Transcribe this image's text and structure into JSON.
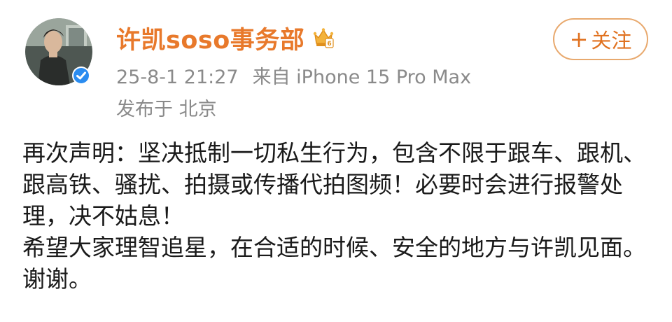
{
  "post": {
    "author": {
      "name": "许凯soso事务部",
      "avatar_icon": "avatar-photo",
      "verified_icon": "verified-badge-icon",
      "vip_icon": "vip-crown-icon"
    },
    "timestamp": "25-8-1 21:27",
    "source": "来自 iPhone 15 Pro Max",
    "location": "发布于 北京",
    "follow_button": {
      "plus": "+",
      "label": "关注"
    },
    "paragraphs": [
      "再次声明：坚决抵制一切私生行为，包含不限于跟车、跟机、跟高铁、骚扰、拍摄或传播代拍图频！必要时会进行报警处理，决不姑息！",
      "希望大家理智追星，在合适的时候、安全的地方与许凯见面。谢谢。"
    ]
  },
  "colors": {
    "username": "#e8792b",
    "meta": "#8a8a8a",
    "follow_border": "#e8a96e",
    "follow_text": "#e0711f",
    "verified_badge": "#2a8cf0",
    "body_text": "#1a1a1a"
  }
}
